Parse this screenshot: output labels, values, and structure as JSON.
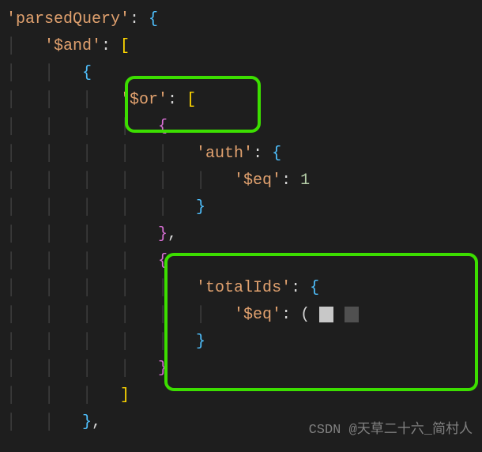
{
  "code": {
    "line1": {
      "key": "'parsedQuery'",
      "colon": ": ",
      "brace": "{"
    },
    "line2": {
      "key": "'$and'",
      "colon": ": ",
      "bracket": "["
    },
    "line3": {
      "brace": "{"
    },
    "line4": {
      "key": "'$or'",
      "colon": ": ",
      "bracket": "["
    },
    "line5": {
      "brace": "{"
    },
    "line6": {
      "key": "'auth'",
      "colon": ": ",
      "brace": "{"
    },
    "line7": {
      "key": "'$eq'",
      "colon": ": ",
      "value": "1"
    },
    "line8": {
      "brace": "}"
    },
    "line9": {
      "brace": "}",
      "comma": ","
    },
    "line10": {
      "brace": "{"
    },
    "line11": {
      "key": "'totalIds'",
      "colon": ": ",
      "brace": "{"
    },
    "line12": {
      "key": "'$eq'",
      "colon": ": ",
      "paren": "("
    },
    "line13": {
      "brace": "}"
    },
    "line14": {
      "brace": "}"
    },
    "line15": {
      "bracket": "]"
    },
    "line16": {
      "brace": "}",
      "comma": ","
    }
  },
  "watermark": "CSDN @天草二十六_简村人",
  "chart_data": {
    "type": "table",
    "description": "MongoDB query explain output showing parsedQuery structure with $and/$or operators, with two highlighted sections ($or clause opening and totalIds block)"
  }
}
